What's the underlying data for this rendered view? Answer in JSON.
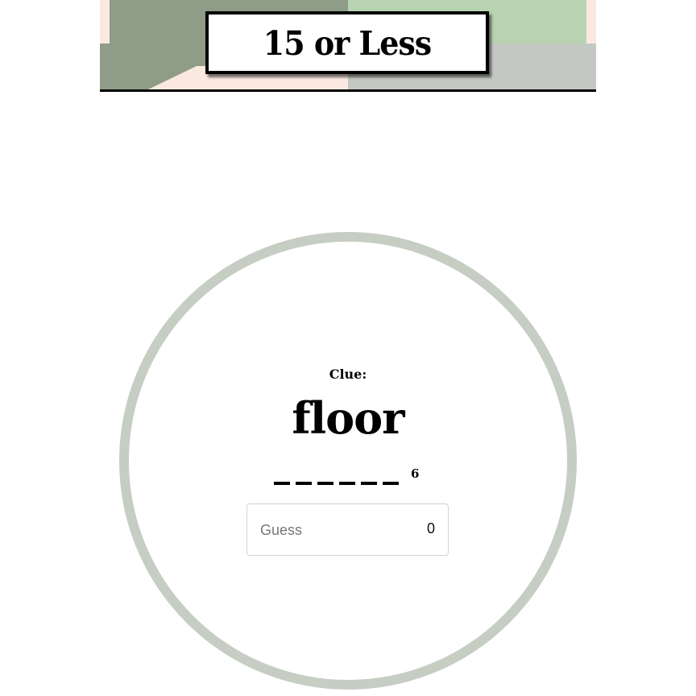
{
  "header": {
    "title": "15 or Less"
  },
  "clue": {
    "label": "Clue:",
    "word": "floor"
  },
  "answer": {
    "blank_count": 6,
    "letter_count_label": "6"
  },
  "guess": {
    "placeholder": "Guess",
    "value": "",
    "count": "0"
  },
  "colors": {
    "ring": "#c6cdc3",
    "header_sage": "#8f9c87",
    "header_mint": "#b7d3b1",
    "header_grey": "#c4c8c2",
    "header_peach": "#fbe9e1"
  }
}
